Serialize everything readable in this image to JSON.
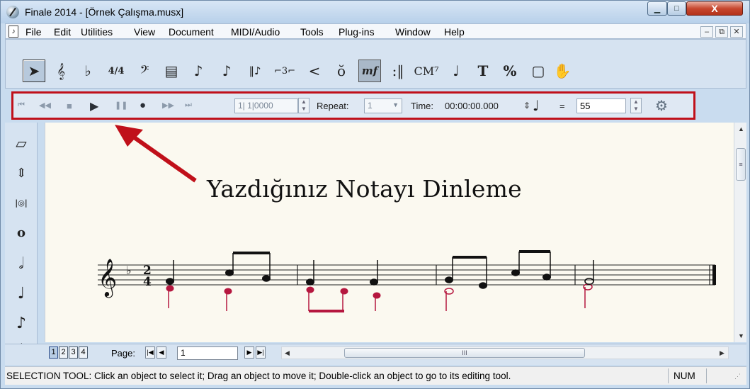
{
  "window": {
    "title": "Finale 2014 - [Örnek Çalışma.musx]",
    "controls": {
      "minimize": "▁",
      "maximize": "□",
      "close": "X"
    }
  },
  "menubar": {
    "doc_icon": "♪",
    "items": [
      "File",
      "Edit",
      "Utilities",
      "View",
      "Document",
      "MIDI/Audio",
      "Tools",
      "Plug-ins",
      "Window",
      "Help"
    ],
    "mdi": [
      "–",
      "⧉",
      "✕"
    ]
  },
  "toolbar": {
    "tools": [
      {
        "name": "selection-tool-icon",
        "glyph": "➤",
        "selected": true
      },
      {
        "name": "staff-tool-icon",
        "glyph": "𝄞"
      },
      {
        "name": "key-signature-tool-icon",
        "glyph": "♭"
      },
      {
        "name": "time-signature-tool-icon",
        "glyph": "4/4"
      },
      {
        "name": "clef-tool-icon",
        "glyph": "𝄢"
      },
      {
        "name": "measure-tool-icon",
        "glyph": "▤"
      },
      {
        "name": "simple-entry-tool-icon",
        "glyph": "♪"
      },
      {
        "name": "speedy-entry-tool-icon",
        "glyph": "♪"
      },
      {
        "name": "hyperscribe-tool-icon",
        "glyph": "‖♪"
      },
      {
        "name": "tuplet-tool-icon",
        "glyph": "⌐3⌐"
      },
      {
        "name": "smart-shape-tool-icon",
        "glyph": "<"
      },
      {
        "name": "articulation-tool-icon",
        "glyph": "ŏ"
      },
      {
        "name": "expression-tool-icon",
        "glyph": "mf"
      },
      {
        "name": "repeat-tool-icon",
        "glyph": ":‖"
      },
      {
        "name": "chord-tool-icon",
        "glyph": "CM⁷"
      },
      {
        "name": "lyrics-tool-icon",
        "glyph": "♩"
      },
      {
        "name": "text-tool-icon",
        "glyph": "T"
      },
      {
        "name": "resize-tool-icon",
        "glyph": "%"
      },
      {
        "name": "page-layout-tool-icon",
        "glyph": "▢"
      },
      {
        "name": "hand-grabber-tool-icon",
        "glyph": "✋"
      }
    ]
  },
  "playback": {
    "buttons": [
      {
        "name": "rewind-to-start-icon",
        "glyph": "⏮"
      },
      {
        "name": "rewind-icon",
        "glyph": "◀◀"
      },
      {
        "name": "stop-icon",
        "glyph": "■"
      },
      {
        "name": "play-icon",
        "glyph": "▶"
      },
      {
        "name": "pause-icon",
        "glyph": "❚❚"
      },
      {
        "name": "record-icon",
        "glyph": "●"
      },
      {
        "name": "fast-forward-icon",
        "glyph": "▶▶"
      },
      {
        "name": "forward-to-end-icon",
        "glyph": "⏭"
      }
    ],
    "position": "1| 1|0000",
    "repeat_label": "Repeat:",
    "repeat_value": "1",
    "time_label": "Time:",
    "time_value": "00:00:00.000",
    "tempo_note": "♩",
    "tempo_equals": "=",
    "tempo_value": "55",
    "settings_icon": "⚙"
  },
  "left_palette": {
    "tools": [
      {
        "name": "eraser-icon",
        "glyph": "▱"
      },
      {
        "name": "move-up-down-icon",
        "glyph": "⇕"
      },
      {
        "name": "tie-icon",
        "glyph": "|◎|"
      },
      {
        "name": "whole-note-icon",
        "glyph": "o"
      },
      {
        "name": "half-note-icon",
        "glyph": "𝅗𝅥"
      },
      {
        "name": "quarter-note-icon",
        "glyph": "♩"
      },
      {
        "name": "eighth-note-icon",
        "glyph": "♪"
      },
      {
        "name": "sixteenth-note-icon",
        "glyph": "𝅘𝅥𝅯"
      }
    ]
  },
  "score": {
    "annotation": "Yazdığınız Notayı Dinleme",
    "arrow_color": "#c0101a",
    "time_signature": {
      "top": "2",
      "bottom": "4"
    }
  },
  "bottombar": {
    "layers": [
      "1",
      "2",
      "3",
      "4"
    ],
    "page_label": "Page:",
    "page_value": "1",
    "scroll_thumb_label": "III"
  },
  "statusbar": {
    "text": "SELECTION TOOL: Click an object to select it; Drag an object to move it; Double-click an object to go to its editing tool.",
    "num": "NUM"
  }
}
